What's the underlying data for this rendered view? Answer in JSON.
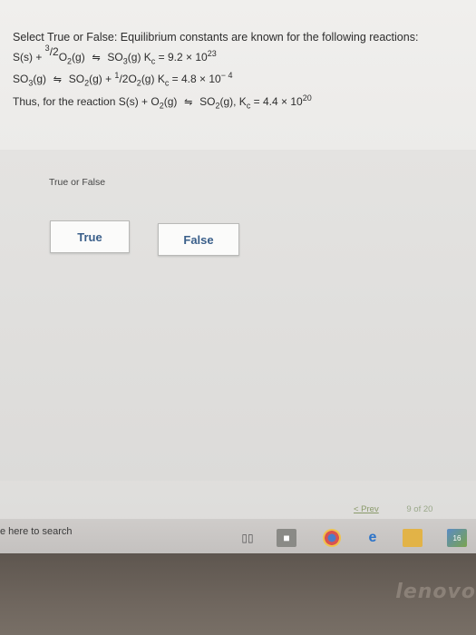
{
  "question": {
    "title": "Select True or False: Equilibrium constants are known for the following reactions:",
    "eq1": {
      "lhs_a": "S(s) + ",
      "frac_num": "3",
      "frac_den": "/2",
      "lhs_b": "O",
      "lhs_sub": "2",
      "lhs_c": "(g)",
      "rhs_a": "SO",
      "rhs_sub": "3",
      "rhs_b": "(g) K",
      "k_sub": "c",
      "k_val": " = 9.2 × 10",
      "k_exp": "23"
    },
    "eq2": {
      "lhs_a": "SO",
      "lhs_sub": "3",
      "lhs_b": "(g)",
      "rhs_a": "SO",
      "rhs_sub": "2",
      "rhs_b": "(g) + ",
      "frac_num": "1",
      "frac_den": "/2",
      "rhs_c": "O",
      "rhs_sub2": "2",
      "rhs_d": "(g) K",
      "k_sub": "c",
      "k_val": " = 4.8 × 10",
      "k_exp": "− 4"
    },
    "eq3": {
      "lhs_a": "Thus, for the reaction S(s) + O",
      "lhs_sub": "2",
      "lhs_b": "(g)",
      "rhs_a": "SO",
      "rhs_sub": "2",
      "rhs_b": "(g), K",
      "k_sub": "c",
      "k_val": " = 4.4 × 10",
      "k_exp": "20"
    },
    "arrow_symbol": "⇋"
  },
  "answer": {
    "label": "True or False",
    "options": [
      "True",
      "False"
    ]
  },
  "pager": {
    "prev_label": "< Prev",
    "count": "9 of 20"
  },
  "taskbar": {
    "search_text": "e here to search",
    "photo_badge": "16"
  },
  "laptop": {
    "logo": "lenovo"
  },
  "colors": {
    "option_text": "#3a5f8a",
    "pager_text": "#8a9a6a"
  }
}
